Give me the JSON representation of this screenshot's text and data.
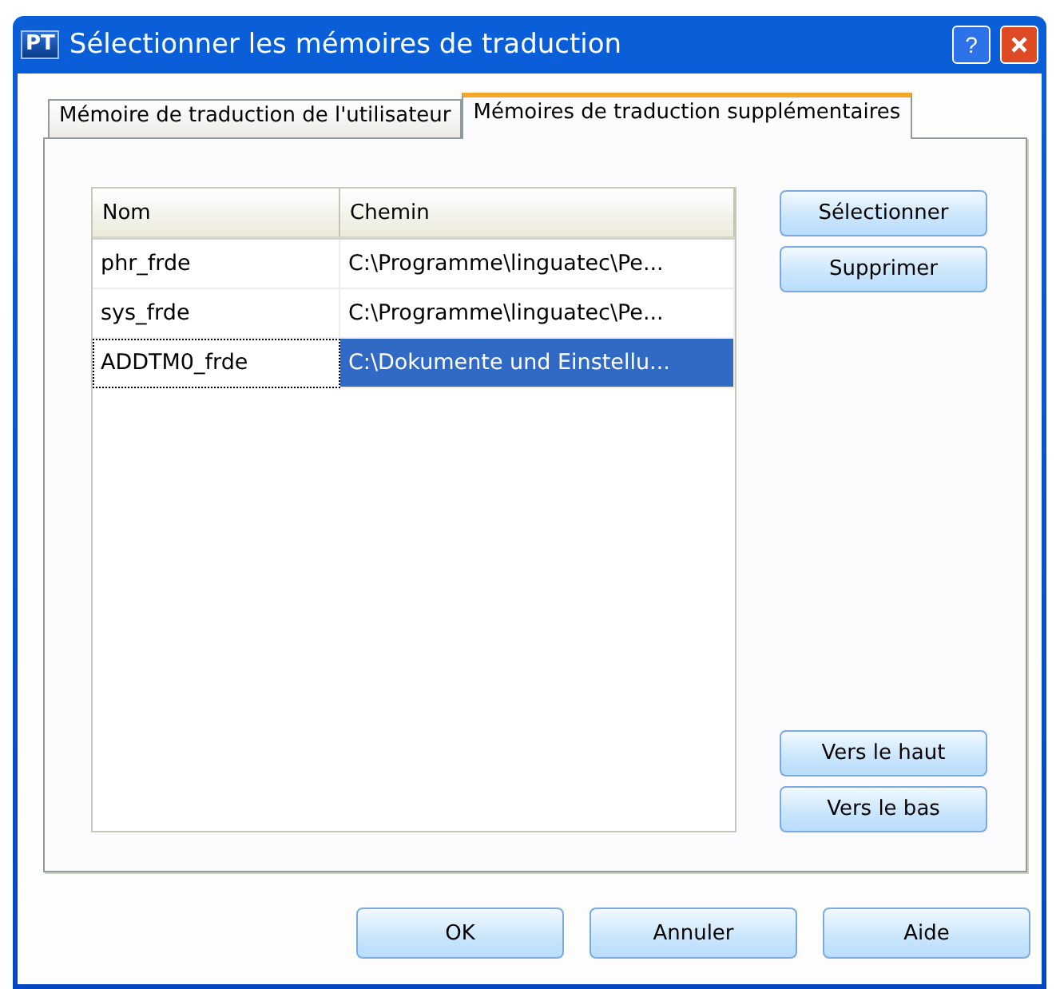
{
  "window": {
    "title": "Sélectionner les mémoires de traduction",
    "logo": "PT",
    "help": "?"
  },
  "tabs": [
    {
      "label": "Mémoire de traduction de l'utilisateur",
      "selected": false
    },
    {
      "label": "Mémoires de traduction supplémentaires",
      "selected": true
    }
  ],
  "table": {
    "columns": [
      "Nom",
      "Chemin"
    ],
    "rows": [
      {
        "cells": [
          "phr_frde",
          "C:\\Programme\\linguatec\\Pe..."
        ],
        "selected": false
      },
      {
        "cells": [
          "sys_frde",
          "C:\\Programme\\linguatec\\Pe..."
        ],
        "selected": false
      },
      {
        "cells": [
          "ADDTM0_frde",
          "C:\\Dokumente und Einstellu..."
        ],
        "selected": true
      }
    ]
  },
  "side_buttons_top": [
    "Sélectionner",
    "Supprimer"
  ],
  "side_buttons_bottom": [
    "Vers le haut",
    "Vers le bas"
  ],
  "buttons": [
    "OK",
    "Annuler",
    "Aide"
  ]
}
